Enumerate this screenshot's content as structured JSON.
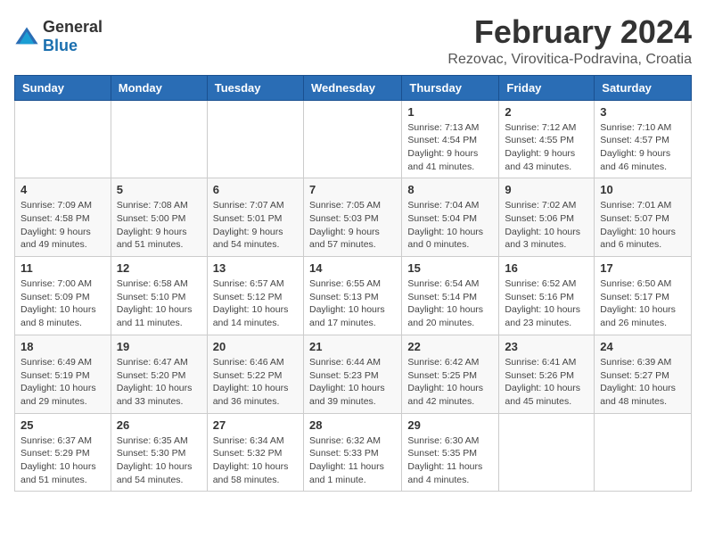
{
  "logo": {
    "general": "General",
    "blue": "Blue"
  },
  "header": {
    "title": "February 2024",
    "subtitle": "Rezovac, Virovitica-Podravina, Croatia"
  },
  "weekdays": [
    "Sunday",
    "Monday",
    "Tuesday",
    "Wednesday",
    "Thursday",
    "Friday",
    "Saturday"
  ],
  "weeks": [
    [
      {
        "day": "",
        "info": ""
      },
      {
        "day": "",
        "info": ""
      },
      {
        "day": "",
        "info": ""
      },
      {
        "day": "",
        "info": ""
      },
      {
        "day": "1",
        "info": "Sunrise: 7:13 AM\nSunset: 4:54 PM\nDaylight: 9 hours\nand 41 minutes."
      },
      {
        "day": "2",
        "info": "Sunrise: 7:12 AM\nSunset: 4:55 PM\nDaylight: 9 hours\nand 43 minutes."
      },
      {
        "day": "3",
        "info": "Sunrise: 7:10 AM\nSunset: 4:57 PM\nDaylight: 9 hours\nand 46 minutes."
      }
    ],
    [
      {
        "day": "4",
        "info": "Sunrise: 7:09 AM\nSunset: 4:58 PM\nDaylight: 9 hours\nand 49 minutes."
      },
      {
        "day": "5",
        "info": "Sunrise: 7:08 AM\nSunset: 5:00 PM\nDaylight: 9 hours\nand 51 minutes."
      },
      {
        "day": "6",
        "info": "Sunrise: 7:07 AM\nSunset: 5:01 PM\nDaylight: 9 hours\nand 54 minutes."
      },
      {
        "day": "7",
        "info": "Sunrise: 7:05 AM\nSunset: 5:03 PM\nDaylight: 9 hours\nand 57 minutes."
      },
      {
        "day": "8",
        "info": "Sunrise: 7:04 AM\nSunset: 5:04 PM\nDaylight: 10 hours\nand 0 minutes."
      },
      {
        "day": "9",
        "info": "Sunrise: 7:02 AM\nSunset: 5:06 PM\nDaylight: 10 hours\nand 3 minutes."
      },
      {
        "day": "10",
        "info": "Sunrise: 7:01 AM\nSunset: 5:07 PM\nDaylight: 10 hours\nand 6 minutes."
      }
    ],
    [
      {
        "day": "11",
        "info": "Sunrise: 7:00 AM\nSunset: 5:09 PM\nDaylight: 10 hours\nand 8 minutes."
      },
      {
        "day": "12",
        "info": "Sunrise: 6:58 AM\nSunset: 5:10 PM\nDaylight: 10 hours\nand 11 minutes."
      },
      {
        "day": "13",
        "info": "Sunrise: 6:57 AM\nSunset: 5:12 PM\nDaylight: 10 hours\nand 14 minutes."
      },
      {
        "day": "14",
        "info": "Sunrise: 6:55 AM\nSunset: 5:13 PM\nDaylight: 10 hours\nand 17 minutes."
      },
      {
        "day": "15",
        "info": "Sunrise: 6:54 AM\nSunset: 5:14 PM\nDaylight: 10 hours\nand 20 minutes."
      },
      {
        "day": "16",
        "info": "Sunrise: 6:52 AM\nSunset: 5:16 PM\nDaylight: 10 hours\nand 23 minutes."
      },
      {
        "day": "17",
        "info": "Sunrise: 6:50 AM\nSunset: 5:17 PM\nDaylight: 10 hours\nand 26 minutes."
      }
    ],
    [
      {
        "day": "18",
        "info": "Sunrise: 6:49 AM\nSunset: 5:19 PM\nDaylight: 10 hours\nand 29 minutes."
      },
      {
        "day": "19",
        "info": "Sunrise: 6:47 AM\nSunset: 5:20 PM\nDaylight: 10 hours\nand 33 minutes."
      },
      {
        "day": "20",
        "info": "Sunrise: 6:46 AM\nSunset: 5:22 PM\nDaylight: 10 hours\nand 36 minutes."
      },
      {
        "day": "21",
        "info": "Sunrise: 6:44 AM\nSunset: 5:23 PM\nDaylight: 10 hours\nand 39 minutes."
      },
      {
        "day": "22",
        "info": "Sunrise: 6:42 AM\nSunset: 5:25 PM\nDaylight: 10 hours\nand 42 minutes."
      },
      {
        "day": "23",
        "info": "Sunrise: 6:41 AM\nSunset: 5:26 PM\nDaylight: 10 hours\nand 45 minutes."
      },
      {
        "day": "24",
        "info": "Sunrise: 6:39 AM\nSunset: 5:27 PM\nDaylight: 10 hours\nand 48 minutes."
      }
    ],
    [
      {
        "day": "25",
        "info": "Sunrise: 6:37 AM\nSunset: 5:29 PM\nDaylight: 10 hours\nand 51 minutes."
      },
      {
        "day": "26",
        "info": "Sunrise: 6:35 AM\nSunset: 5:30 PM\nDaylight: 10 hours\nand 54 minutes."
      },
      {
        "day": "27",
        "info": "Sunrise: 6:34 AM\nSunset: 5:32 PM\nDaylight: 10 hours\nand 58 minutes."
      },
      {
        "day": "28",
        "info": "Sunrise: 6:32 AM\nSunset: 5:33 PM\nDaylight: 11 hours\nand 1 minute."
      },
      {
        "day": "29",
        "info": "Sunrise: 6:30 AM\nSunset: 5:35 PM\nDaylight: 11 hours\nand 4 minutes."
      },
      {
        "day": "",
        "info": ""
      },
      {
        "day": "",
        "info": ""
      }
    ]
  ]
}
